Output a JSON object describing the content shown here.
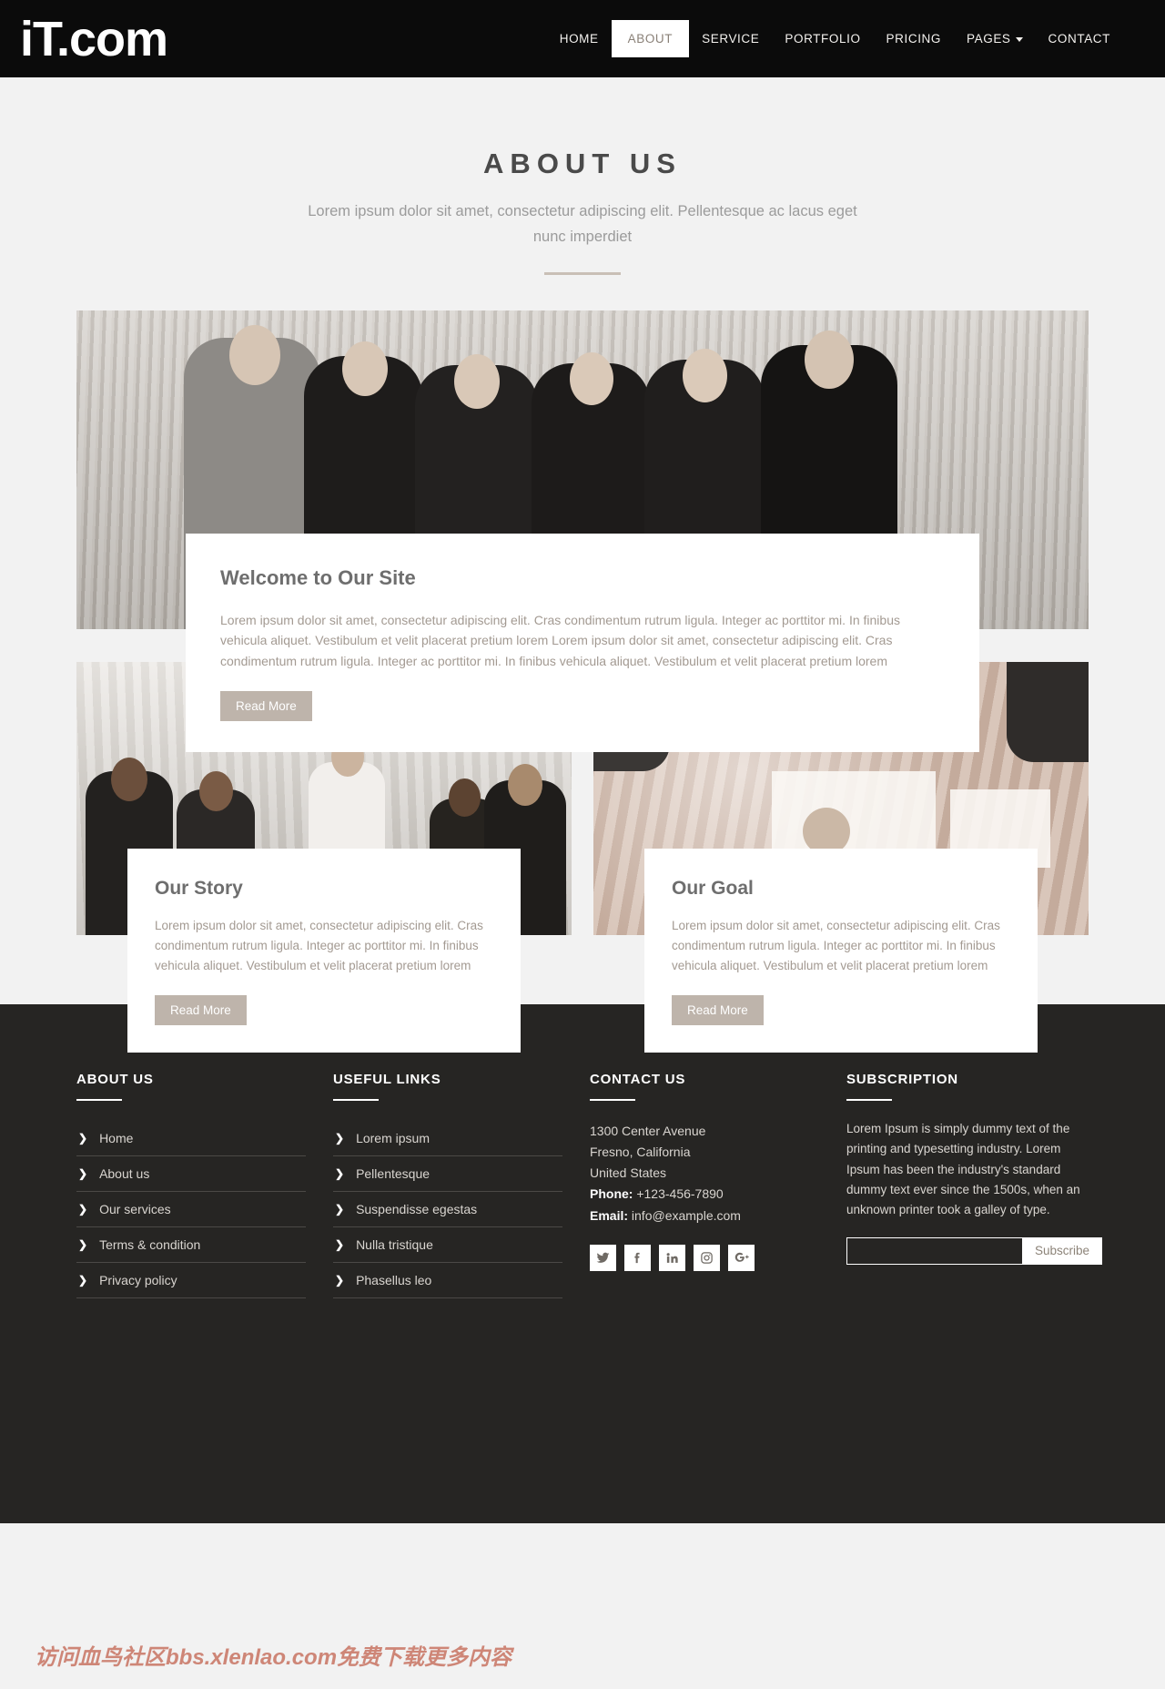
{
  "header": {
    "brand": "iT.com",
    "nav": [
      {
        "label": "HOME",
        "active": false,
        "caret": false
      },
      {
        "label": "ABOUT",
        "active": true,
        "caret": false
      },
      {
        "label": "SERVICE",
        "active": false,
        "caret": false
      },
      {
        "label": "PORTFOLIO",
        "active": false,
        "caret": false
      },
      {
        "label": "PRICING",
        "active": false,
        "caret": false
      },
      {
        "label": "PAGES",
        "active": false,
        "caret": true
      },
      {
        "label": "CONTACT",
        "active": false,
        "caret": false
      }
    ]
  },
  "page": {
    "title": "ABOUT US",
    "subtitle": "Lorem ipsum dolor sit amet, consectetur adipiscing elit. Pellentesque ac lacus eget nunc imperdiet"
  },
  "hero": {
    "card_title": "Welcome to Our Site",
    "card_text": "Lorem ipsum dolor sit amet, consectetur adipiscing elit. Cras condimentum rutrum ligula. Integer ac porttitor mi. In finibus vehicula aliquet. Vestibulum et velit placerat pretium lorem Lorem ipsum dolor sit amet, consectetur adipiscing elit. Cras condimentum rutrum ligula. Integer ac porttitor mi. In finibus vehicula aliquet. Vestibulum et velit placerat pretium lorem",
    "button": "Read More",
    "image_alt": "team-of-six-business-people-photo"
  },
  "cards": [
    {
      "title": "Our Story",
      "text": "Lorem ipsum dolor sit amet, consectetur adipiscing elit. Cras condimentum rutrum ligula. Integer ac porttitor mi. In finibus vehicula aliquet. Vestibulum et velit placerat pretium lorem",
      "button": "Read More",
      "image_alt": "office-meeting-photo"
    },
    {
      "title": "Our Goal",
      "text": "Lorem ipsum dolor sit amet, consectetur adipiscing elit. Cras condimentum rutrum ligula. Integer ac porttitor mi. In finibus vehicula aliquet. Vestibulum et velit placerat pretium lorem",
      "button": "Read More",
      "image_alt": "desk-with-charts-and-coffee-photo"
    }
  ],
  "footer": {
    "about": {
      "heading": "ABOUT US",
      "links": [
        "Home",
        "About us",
        "Our services",
        "Terms & condition",
        "Privacy policy"
      ]
    },
    "useful": {
      "heading": "USEFUL LINKS",
      "links": [
        "Lorem ipsum",
        "Pellentesque",
        "Suspendisse egestas",
        "Nulla tristique",
        "Phasellus leo"
      ]
    },
    "contact": {
      "heading": "CONTACT US",
      "address1": "1300 Center Avenue",
      "address2": "Fresno, California",
      "address3": "United States",
      "phone_label": "Phone:",
      "phone_value": "+123-456-7890",
      "email_label": "Email:",
      "email_value": "info@example.com",
      "socials": [
        "twitter-icon",
        "facebook-icon",
        "linkedin-icon",
        "instagram-icon",
        "google-plus-icon"
      ]
    },
    "subscription": {
      "heading": "SUBSCRIPTION",
      "text": "Lorem Ipsum is simply dummy text of the printing and typesetting industry. Lorem Ipsum has been the industry's standard dummy text ever since the 1500s, when an unknown printer took a galley of type.",
      "input_value": "",
      "input_placeholder": "",
      "button": "Subscribe"
    }
  },
  "watermark": "访问血鸟社区bbs.xlenlao.com免费下载更多内容",
  "colors": {
    "header_bg": "#0b0b0b",
    "page_bg": "#f2f2f2",
    "footer_bg": "#262523",
    "accent": "#c9bfb6",
    "button_bg": "#968678",
    "title_color": "#4a4a4a"
  }
}
